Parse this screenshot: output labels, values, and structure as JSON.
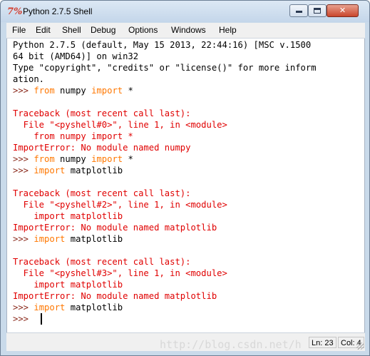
{
  "window": {
    "title": "Python 2.7.5 Shell",
    "icon": "python-idle-icon",
    "close_label": "✕"
  },
  "menu": [
    "File",
    "Edit",
    "Shell",
    "Debug",
    "Options",
    "Windows",
    "Help"
  ],
  "console": [
    [
      {
        "t": "Python 2.7.5 (default, May 15 2013, 22:44:16) [MSC v.1500",
        "c": "out"
      }
    ],
    [
      {
        "t": "64 bit (AMD64)] on win32",
        "c": "out"
      }
    ],
    [
      {
        "t": "Type \"copyright\", \"credits\" or \"license()\" for more inform",
        "c": "out"
      }
    ],
    [
      {
        "t": "ation.",
        "c": "out"
      }
    ],
    [
      {
        "t": ">>> ",
        "c": "prompt"
      },
      {
        "t": "from",
        "c": "kw"
      },
      {
        "t": " numpy ",
        "c": "out"
      },
      {
        "t": "import",
        "c": "kw"
      },
      {
        "t": " *",
        "c": "out"
      }
    ],
    [],
    [
      {
        "t": "Traceback (most recent call last):",
        "c": "err"
      }
    ],
    [
      {
        "t": "  File \"<pyshell#0>\", line 1, in <module>",
        "c": "err"
      }
    ],
    [
      {
        "t": "    from numpy import *",
        "c": "err"
      }
    ],
    [
      {
        "t": "ImportError: No module named numpy",
        "c": "err"
      }
    ],
    [
      {
        "t": ">>> ",
        "c": "prompt"
      },
      {
        "t": "from",
        "c": "kw"
      },
      {
        "t": " numpy ",
        "c": "out"
      },
      {
        "t": "import",
        "c": "kw"
      },
      {
        "t": " *",
        "c": "out"
      }
    ],
    [
      {
        "t": ">>> ",
        "c": "prompt"
      },
      {
        "t": "import",
        "c": "kw"
      },
      {
        "t": " matplotlib",
        "c": "out"
      }
    ],
    [],
    [
      {
        "t": "Traceback (most recent call last):",
        "c": "err"
      }
    ],
    [
      {
        "t": "  File \"<pyshell#2>\", line 1, in <module>",
        "c": "err"
      }
    ],
    [
      {
        "t": "    import matplotlib",
        "c": "err"
      }
    ],
    [
      {
        "t": "ImportError: No module named matplotlib",
        "c": "err"
      }
    ],
    [
      {
        "t": ">>> ",
        "c": "prompt"
      },
      {
        "t": "import",
        "c": "kw"
      },
      {
        "t": " matplotlib",
        "c": "out"
      }
    ],
    [],
    [
      {
        "t": "Traceback (most recent call last):",
        "c": "err"
      }
    ],
    [
      {
        "t": "  File \"<pyshell#3>\", line 1, in <module>",
        "c": "err"
      }
    ],
    [
      {
        "t": "    import matplotlib",
        "c": "err"
      }
    ],
    [
      {
        "t": "ImportError: No module named matplotlib",
        "c": "err"
      }
    ],
    [
      {
        "t": ">>> ",
        "c": "prompt"
      },
      {
        "t": "import",
        "c": "kw"
      },
      {
        "t": " matplotlib",
        "c": "out"
      }
    ],
    [
      {
        "t": ">>> ",
        "c": "prompt"
      }
    ]
  ],
  "colors": {
    "prompt": "#8b2a1c",
    "error": "#e00000",
    "keyword": "#ff7700",
    "output": "#000000"
  },
  "status": {
    "line": "Ln: 23",
    "col": "Col: 4"
  },
  "watermark": "http://blog.csdn.net/h"
}
